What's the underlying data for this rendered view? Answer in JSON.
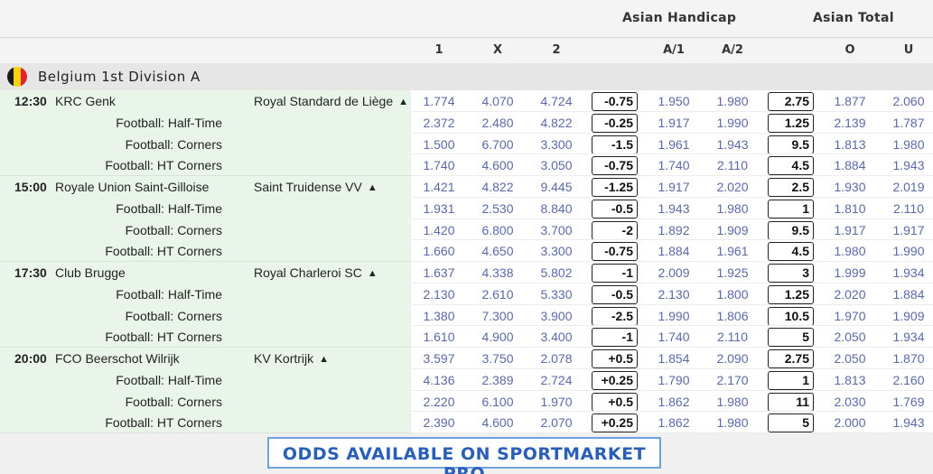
{
  "header": {
    "asian_handicap": "Asian Handicap",
    "asian_total": "Asian Total",
    "columns": [
      "1",
      "X",
      "2",
      "A/1",
      "A/2",
      "O",
      "U"
    ]
  },
  "league": {
    "name": "Belgium 1st Division A",
    "flag_colors": [
      "#1a1a1a",
      "#f5d40f",
      "#e3222b"
    ]
  },
  "colors": {
    "odds_text": "#5a6aa8",
    "event_bg": "#eaf5ea",
    "banner_text": "#2a5fb8"
  },
  "events": [
    {
      "time": "12:30",
      "home": "KRC Genk",
      "away": "Royal Standard de Liège",
      "rows": [
        {
          "market": "",
          "o1": "1.774",
          "ox": "4.070",
          "o2": "4.724",
          "ah_line": "-0.75",
          "a1": "1.950",
          "a2": "1.980",
          "at_line": "2.75",
          "over": "1.877",
          "under": "2.060"
        },
        {
          "market": "Football: Half-Time",
          "o1": "2.372",
          "ox": "2.480",
          "o2": "4.822",
          "ah_line": "-0.25",
          "a1": "1.917",
          "a2": "1.990",
          "at_line": "1.25",
          "over": "2.139",
          "under": "1.787"
        },
        {
          "market": "Football: Corners",
          "o1": "1.500",
          "ox": "6.700",
          "o2": "3.300",
          "ah_line": "-1.5",
          "a1": "1.961",
          "a2": "1.943",
          "at_line": "9.5",
          "over": "1.813",
          "under": "1.980"
        },
        {
          "market": "Football: HT Corners",
          "o1": "1.740",
          "ox": "4.600",
          "o2": "3.050",
          "ah_line": "-0.75",
          "a1": "1.740",
          "a2": "2.110",
          "at_line": "4.5",
          "over": "1.884",
          "under": "1.943"
        }
      ]
    },
    {
      "time": "15:00",
      "home": "Royale Union Saint-Gilloise",
      "away": "Saint Truidense VV",
      "rows": [
        {
          "market": "",
          "o1": "1.421",
          "ox": "4.822",
          "o2": "9.445",
          "ah_line": "-1.25",
          "a1": "1.917",
          "a2": "2.020",
          "at_line": "2.5",
          "over": "1.930",
          "under": "2.019"
        },
        {
          "market": "Football: Half-Time",
          "o1": "1.931",
          "ox": "2.530",
          "o2": "8.840",
          "ah_line": "-0.5",
          "a1": "1.943",
          "a2": "1.980",
          "at_line": "1",
          "over": "1.810",
          "under": "2.110"
        },
        {
          "market": "Football: Corners",
          "o1": "1.420",
          "ox": "6.800",
          "o2": "3.700",
          "ah_line": "-2",
          "a1": "1.892",
          "a2": "1.909",
          "at_line": "9.5",
          "over": "1.917",
          "under": "1.917"
        },
        {
          "market": "Football: HT Corners",
          "o1": "1.660",
          "ox": "4.650",
          "o2": "3.300",
          "ah_line": "-0.75",
          "a1": "1.884",
          "a2": "1.961",
          "at_line": "4.5",
          "over": "1.980",
          "under": "1.990"
        }
      ]
    },
    {
      "time": "17:30",
      "home": "Club Brugge",
      "away": "Royal Charleroi SC",
      "rows": [
        {
          "market": "",
          "o1": "1.637",
          "ox": "4.338",
          "o2": "5.802",
          "ah_line": "-1",
          "a1": "2.009",
          "a2": "1.925",
          "at_line": "3",
          "over": "1.999",
          "under": "1.934"
        },
        {
          "market": "Football: Half-Time",
          "o1": "2.130",
          "ox": "2.610",
          "o2": "5.330",
          "ah_line": "-0.5",
          "a1": "2.130",
          "a2": "1.800",
          "at_line": "1.25",
          "over": "2.020",
          "under": "1.884"
        },
        {
          "market": "Football: Corners",
          "o1": "1.380",
          "ox": "7.300",
          "o2": "3.900",
          "ah_line": "-2.5",
          "a1": "1.990",
          "a2": "1.806",
          "at_line": "10.5",
          "over": "1.970",
          "under": "1.909"
        },
        {
          "market": "Football: HT Corners",
          "o1": "1.610",
          "ox": "4.900",
          "o2": "3.400",
          "ah_line": "-1",
          "a1": "1.740",
          "a2": "2.110",
          "at_line": "5",
          "over": "2.050",
          "under": "1.934"
        }
      ]
    },
    {
      "time": "20:00",
      "home": "FCO Beerschot Wilrijk",
      "away": "KV Kortrijk",
      "rows": [
        {
          "market": "",
          "o1": "3.597",
          "ox": "3.750",
          "o2": "2.078",
          "ah_line": "+0.5",
          "a1": "1.854",
          "a2": "2.090",
          "at_line": "2.75",
          "over": "2.050",
          "under": "1.870"
        },
        {
          "market": "Football: Half-Time",
          "o1": "4.136",
          "ox": "2.389",
          "o2": "2.724",
          "ah_line": "+0.25",
          "a1": "1.790",
          "a2": "2.170",
          "at_line": "1",
          "over": "1.813",
          "under": "2.160"
        },
        {
          "market": "Football: Corners",
          "o1": "2.220",
          "ox": "6.100",
          "o2": "1.970",
          "ah_line": "+0.5",
          "a1": "1.862",
          "a2": "1.980",
          "at_line": "11",
          "over": "2.030",
          "under": "1.769"
        },
        {
          "market": "Football: HT Corners",
          "o1": "2.390",
          "ox": "4.600",
          "o2": "2.070",
          "ah_line": "+0.25",
          "a1": "1.862",
          "a2": "1.980",
          "at_line": "5",
          "over": "2.000",
          "under": "1.943"
        }
      ]
    }
  ],
  "banner": {
    "text": "ODDS AVAILABLE ON SPORTMARKET PRO"
  }
}
